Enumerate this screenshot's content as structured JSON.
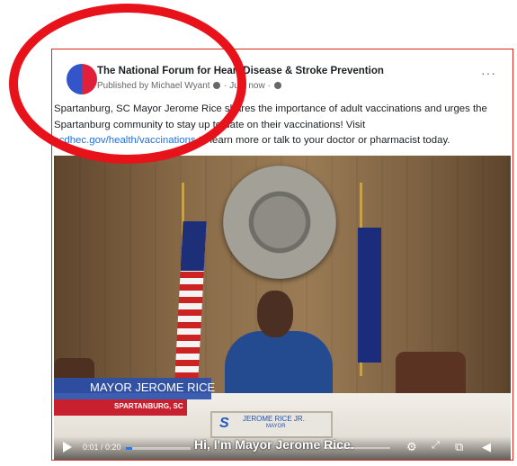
{
  "post": {
    "page_name": "The National Forum for Heart Disease & Stroke Prevention",
    "published_by": "Published by Michael Wyant",
    "time": "Just now",
    "more": "···",
    "text_part1": "Spartanburg, SC Mayor Jerome Rice shares the importance of adult vaccinations and urges the Spartanburg community to stay up to date on their vaccinations! Visit ",
    "link": "scdhec.gov/health/vaccinations",
    "text_part2": " to learn more or talk to your doctor or pharmacist today."
  },
  "video": {
    "lower_third_name": "MAYOR JEROME RICE",
    "lower_third_sub": "SPARTANBURG, SC",
    "nameplate_logo": "S",
    "nameplate_name": "JEROME RICE JR.",
    "nameplate_title": "MAYOR",
    "time": "0:01 / 0:20",
    "caption": "Hi, I'm Mayor Jerome Rice.",
    "progress_fraction": 0.05
  },
  "colors": {
    "accent_link": "#216fdb",
    "annotation": "#e8121a",
    "card_border": "#d9291c"
  }
}
